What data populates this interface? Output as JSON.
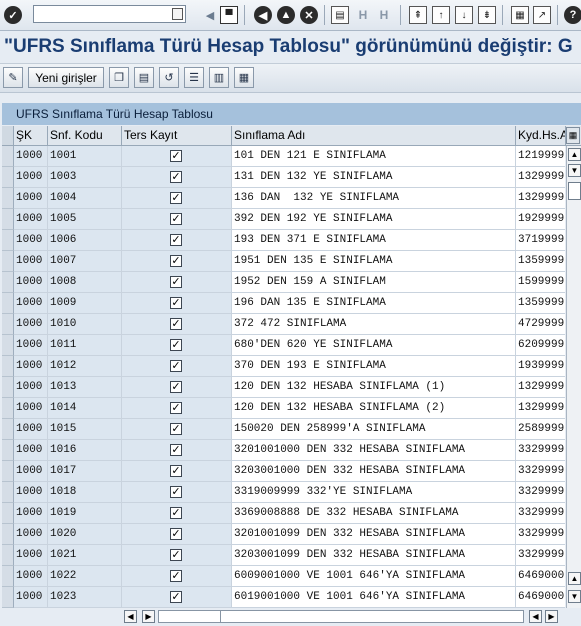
{
  "system_toolbar": {
    "command_field_value": "",
    "icons": [
      "enter-icon",
      "dropdown-icon",
      "back-arrow-icon",
      "save-icon",
      "back-icon",
      "exit-icon",
      "cancel-icon",
      "print-icon",
      "find-icon",
      "find-next-icon",
      "first-page-icon",
      "previous-page-icon",
      "next-page-icon",
      "last-page-icon",
      "create-session-icon",
      "shortcut-icon",
      "help-icon"
    ]
  },
  "title": "\"UFRS Sınıflama Türü Hesap Tablosu\" görünümünü değiştir: G",
  "app_toolbar": {
    "new_entries_label": "Yeni girişler"
  },
  "table": {
    "caption": "UFRS Sınıflama Türü Hesap Tablosu",
    "columns": [
      "ŞK",
      "Snf. Kodu",
      "Ters Kayıt",
      "Sınıflama Adı",
      "Kyd.Hs.A"
    ],
    "rows": [
      {
        "sk": "1000",
        "code": "1001",
        "reverse": true,
        "name": "101 DEN 121 E SINIFLAMA",
        "acct": "1219999"
      },
      {
        "sk": "1000",
        "code": "1003",
        "reverse": true,
        "name": "131 DEN 132 YE SINIFLAMA",
        "acct": "1329999"
      },
      {
        "sk": "1000",
        "code": "1004",
        "reverse": true,
        "name": "136 DAN  132 YE SINIFLAMA",
        "acct": "1329999"
      },
      {
        "sk": "1000",
        "code": "1005",
        "reverse": true,
        "name": "392 DEN 192 YE SINIFLAMA",
        "acct": "1929999"
      },
      {
        "sk": "1000",
        "code": "1006",
        "reverse": true,
        "name": "193 DEN 371 E SINIFLAMA",
        "acct": "3719999"
      },
      {
        "sk": "1000",
        "code": "1007",
        "reverse": true,
        "name": "1951 DEN 135 E SINIFLAMA",
        "acct": "1359999"
      },
      {
        "sk": "1000",
        "code": "1008",
        "reverse": true,
        "name": "1952 DEN 159 A SINIFLAM",
        "acct": "1599999"
      },
      {
        "sk": "1000",
        "code": "1009",
        "reverse": true,
        "name": "196 DAN 135 E SINIFLAMA",
        "acct": "1359999"
      },
      {
        "sk": "1000",
        "code": "1010",
        "reverse": true,
        "name": "372 472 SINIFLAMA",
        "acct": "4729999"
      },
      {
        "sk": "1000",
        "code": "1011",
        "reverse": true,
        "name": "680'DEN 620 YE SINIFLAMA",
        "acct": "6209999"
      },
      {
        "sk": "1000",
        "code": "1012",
        "reverse": true,
        "name": "370 DEN 193 E SINIFLAMA",
        "acct": "1939999"
      },
      {
        "sk": "1000",
        "code": "1013",
        "reverse": true,
        "name": "120 DEN 132 HESABA SINIFLAMA (1)",
        "acct": "1329999"
      },
      {
        "sk": "1000",
        "code": "1014",
        "reverse": true,
        "name": "120 DEN 132 HESABA SINIFLAMA (2)",
        "acct": "1329999"
      },
      {
        "sk": "1000",
        "code": "1015",
        "reverse": true,
        "name": "150020 DEN 258999'A SINIFLAMA",
        "acct": "2589999"
      },
      {
        "sk": "1000",
        "code": "1016",
        "reverse": true,
        "name": "3201001000 DEN 332 HESABA SINIFLAMA",
        "acct": "3329999"
      },
      {
        "sk": "1000",
        "code": "1017",
        "reverse": true,
        "name": "3203001000 DEN 332 HESABA SINIFLAMA",
        "acct": "3329999"
      },
      {
        "sk": "1000",
        "code": "1018",
        "reverse": true,
        "name": "3319009999 332'YE SINIFLAMA",
        "acct": "3329999"
      },
      {
        "sk": "1000",
        "code": "1019",
        "reverse": true,
        "name": "3369008888 DE 332 HESABA SINIFLAMA",
        "acct": "3329999"
      },
      {
        "sk": "1000",
        "code": "1020",
        "reverse": true,
        "name": "3201001099 DEN 332 HESABA SINIFLAMA",
        "acct": "3329999"
      },
      {
        "sk": "1000",
        "code": "1021",
        "reverse": true,
        "name": "3203001099 DEN 332 HESABA SINIFLAMA",
        "acct": "3329999"
      },
      {
        "sk": "1000",
        "code": "1022",
        "reverse": true,
        "name": "6009001000 VE 1001 646'YA SINIFLAMA",
        "acct": "6469000"
      },
      {
        "sk": "1000",
        "code": "1023",
        "reverse": true,
        "name": "6019001000 VE 1001 646'YA SINIFLAMA",
        "acct": "6469000"
      }
    ]
  }
}
